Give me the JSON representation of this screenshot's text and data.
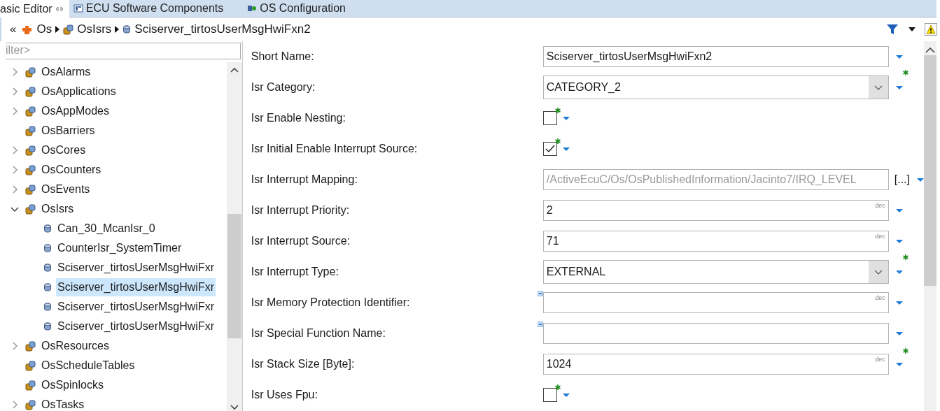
{
  "tabs": [
    {
      "label": "asic Editor",
      "selected": true,
      "closable": true
    },
    {
      "label": "ECU Software Components",
      "selected": false,
      "closable": false
    },
    {
      "label": "OS Configuration",
      "selected": false,
      "closable": false
    }
  ],
  "breadcrumb": {
    "back": "«",
    "items": [
      {
        "label": "Os",
        "kind": "module"
      },
      {
        "label": "OsIsrs",
        "kind": "container"
      },
      {
        "label": "Sciserver_tirtosUserMsgHwiFxn2",
        "kind": "item"
      }
    ]
  },
  "filter": {
    "placeholder": "ilter>"
  },
  "tree": [
    {
      "label": "OsAlarms",
      "kind": "container",
      "expanded": false,
      "selected": false
    },
    {
      "label": "OsApplications",
      "kind": "container",
      "expanded": false,
      "selected": false
    },
    {
      "label": "OsAppModes",
      "kind": "container",
      "expanded": false,
      "selected": false
    },
    {
      "label": "OsBarriers",
      "kind": "container",
      "selected": false
    },
    {
      "label": "OsCores",
      "kind": "container",
      "expanded": false,
      "selected": false
    },
    {
      "label": "OsCounters",
      "kind": "container",
      "expanded": false,
      "selected": false
    },
    {
      "label": "OsEvents",
      "kind": "container",
      "expanded": false,
      "selected": false
    },
    {
      "label": "OsIsrs",
      "kind": "container",
      "expanded": true,
      "selected": false,
      "children": [
        {
          "label": "Can_30_McanIsr_0",
          "kind": "item",
          "selected": false
        },
        {
          "label": "CounterIsr_SystemTimer",
          "kind": "item",
          "selected": false
        },
        {
          "label": "Sciserver_tirtosUserMsgHwiFxr",
          "kind": "item",
          "selected": false
        },
        {
          "label": "Sciserver_tirtosUserMsgHwiFxr",
          "kind": "item",
          "selected": true
        },
        {
          "label": "Sciserver_tirtosUserMsgHwiFxr",
          "kind": "item",
          "selected": false
        },
        {
          "label": "Sciserver_tirtosUserMsgHwiFxr",
          "kind": "item",
          "selected": false
        }
      ]
    },
    {
      "label": "OsResources",
      "kind": "container",
      "expanded": false,
      "selected": false
    },
    {
      "label": "OsScheduleTables",
      "kind": "container",
      "selected": false
    },
    {
      "label": "OsSpinlocks",
      "kind": "container",
      "selected": false
    },
    {
      "label": "OsTasks",
      "kind": "container",
      "expanded": false,
      "selected": false
    }
  ],
  "form": [
    {
      "label": "Short Name:",
      "kind": "text",
      "value": "Sciserver_tirtosUserMsgHwiFxn2",
      "modified": false,
      "marker": false
    },
    {
      "label": "Isr Category:",
      "kind": "combo",
      "value": "CATEGORY_2",
      "modified": true,
      "marker": false
    },
    {
      "label": "Isr Enable Nesting:",
      "kind": "checkbox",
      "checked": false,
      "modified": true,
      "marker": false
    },
    {
      "label": "Isr Initial Enable Interrupt Source:",
      "kind": "checkbox",
      "checked": true,
      "modified": true,
      "marker": false
    },
    {
      "label": "Isr Interrupt Mapping:",
      "kind": "reference",
      "path": "/ActiveEcuC/Os/OsPublishedInformation/Jacinto7/",
      "value": "IRQ_LEVEL",
      "button": "[...]",
      "modified": false,
      "marker": false
    },
    {
      "label": "Isr Interrupt Priority:",
      "kind": "number",
      "value": "2",
      "unit": "dec",
      "modified": false,
      "marker": false
    },
    {
      "label": "Isr Interrupt Source:",
      "kind": "number",
      "value": "71",
      "unit": "dec",
      "modified": false,
      "marker": false
    },
    {
      "label": "Isr Interrupt Type:",
      "kind": "combo",
      "value": "EXTERNAL",
      "modified": true,
      "marker": false
    },
    {
      "label": "Isr Memory Protection Identifier:",
      "kind": "number",
      "unit": "dec",
      "modified": false,
      "marker": true
    },
    {
      "label": "Isr Special Function Name:",
      "kind": "text",
      "modified": false,
      "marker": true
    },
    {
      "label": "Isr Stack Size [Byte]:",
      "kind": "number",
      "value": "1024",
      "unit": "dec",
      "modified": true,
      "marker": false
    },
    {
      "label": "Isr Uses Fpu:",
      "kind": "checkbox",
      "checked": false,
      "modified": true,
      "marker": false
    }
  ]
}
